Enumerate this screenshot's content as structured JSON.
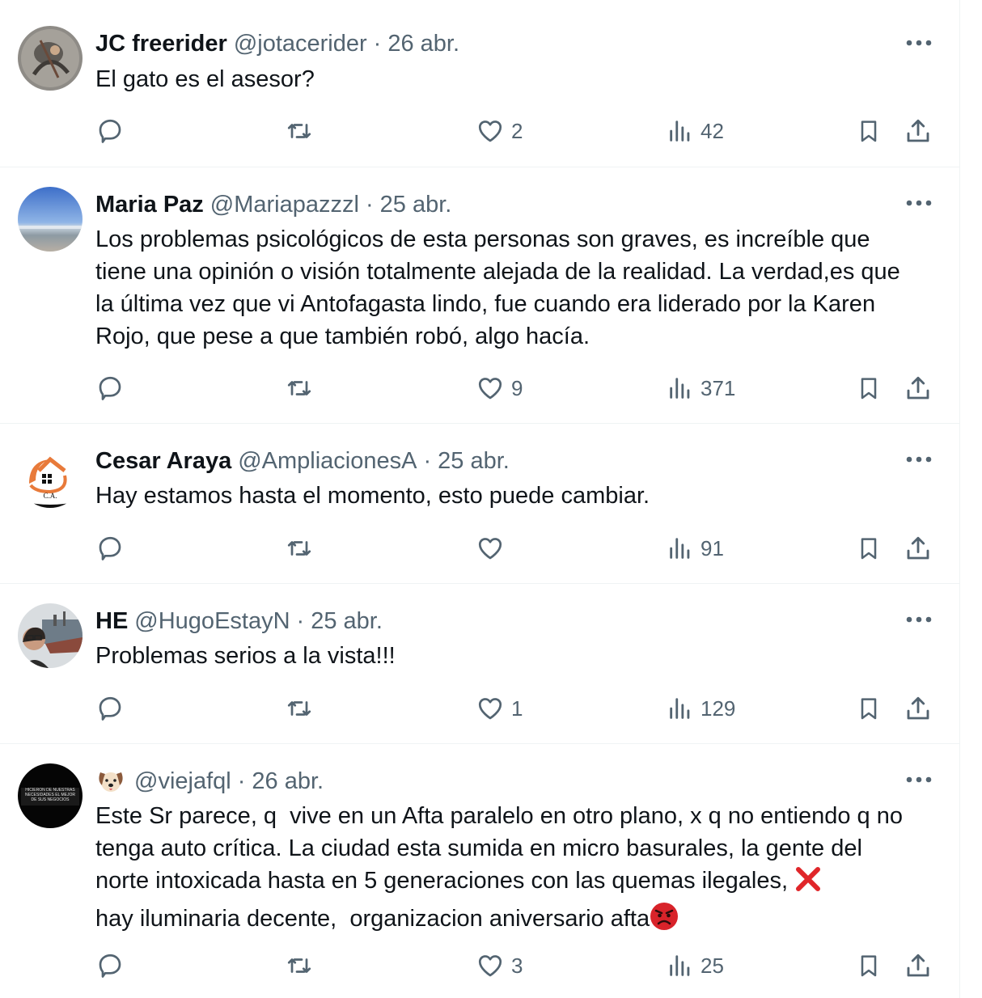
{
  "tweets": [
    {
      "name": "JC freerider",
      "handle": "@jotacerider",
      "separator": "·",
      "date": "26 abr.",
      "text": "El gato es el asesor?",
      "replies": "",
      "retweets": "",
      "likes": "2",
      "views": "42"
    },
    {
      "name": "Maria Paz",
      "handle": "@Mariapazzzl",
      "separator": "·",
      "date": "25 abr.",
      "text": "Los problemas psicológicos de esta personas son graves, es increíble que tiene una opinión o visión totalmente alejada de la realidad. La verdad,es que la última vez que vi Antofagasta lindo, fue cuando era liderado por la Karen Rojo, que pese a que también robó, algo hacía.",
      "replies": "",
      "retweets": "",
      "likes": "9",
      "views": "371"
    },
    {
      "name": "Cesar Araya",
      "handle": "@AmpliacionesA",
      "separator": "·",
      "date": "25 abr.",
      "text": "Hay estamos hasta el momento, esto puede cambiar.",
      "avatar_text": "C.A.",
      "replies": "",
      "retweets": "",
      "likes": "",
      "views": "91"
    },
    {
      "name": "HE",
      "handle": "@HugoEstayN",
      "separator": "·",
      "date": "25 abr.",
      "text": "Problemas serios a la vista!!!",
      "replies": "",
      "retweets": "",
      "likes": "1",
      "views": "129"
    },
    {
      "name_emoji": "dog-face-emoji",
      "handle": "@viejafql",
      "separator": "·",
      "date": "26 abr.",
      "text_part1": "Este Sr parece, q  vive en un Afta paralelo en otro plano, x q no entiendo q no tenga auto crítica. La ciudad esta sumida en micro basurales, la gente del norte intoxicada hasta en 5 generaciones con las quemas ilegales, ",
      "text_emoji1": "cross-mark-emoji",
      "text_part2": "\nhay iluminaria decente,  organizacion aniversario afta",
      "text_emoji2": "angry-face-emoji",
      "avatar_text": "HICIERON DE NUESTRAS NECESIDADES EL MEJOR DE SUS NEGOCIOS",
      "replies": "",
      "retweets": "",
      "likes": "3",
      "views": "25"
    }
  ],
  "colors": {
    "text": "#0f1419",
    "secondary": "#536471",
    "divider": "#eff3f4",
    "cross": "#e0262a",
    "angry": "#d8232a"
  }
}
